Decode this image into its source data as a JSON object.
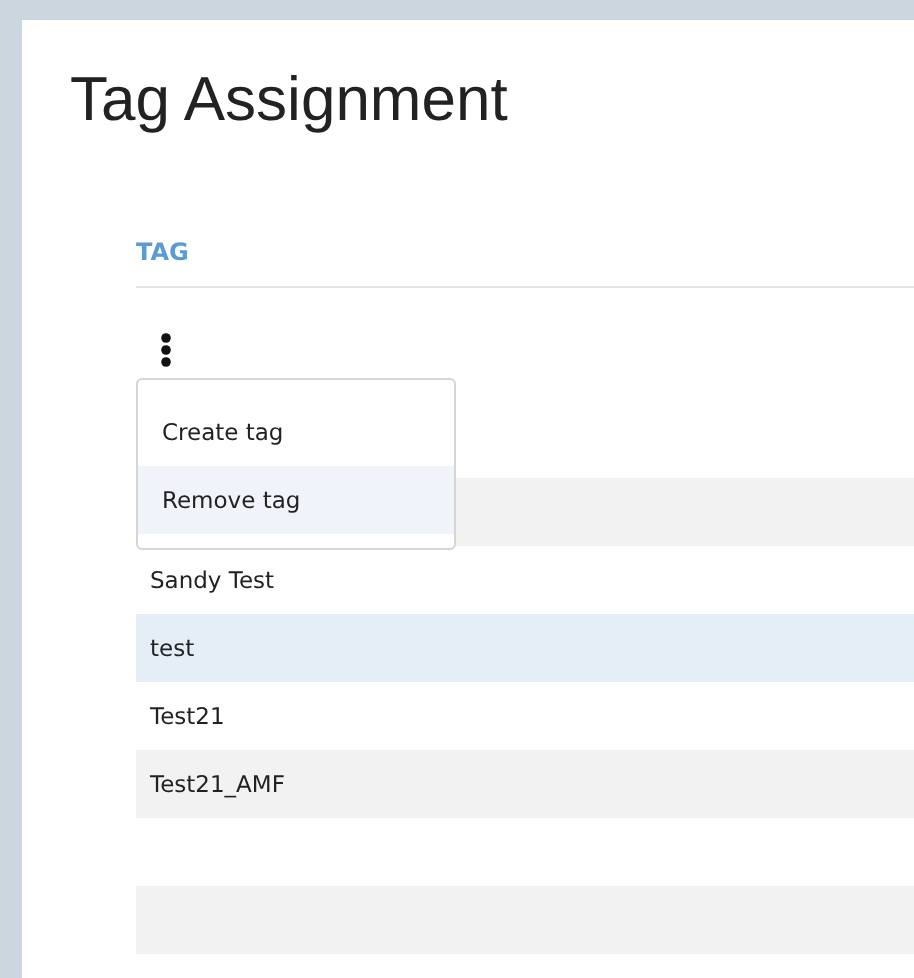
{
  "title": "Tag Assignment",
  "table": {
    "columns": [
      "TAG"
    ],
    "rows": [
      {
        "selected": false
      },
      {
        "selected": false
      },
      {
        "name": "Sandy Test",
        "selected": false
      },
      {
        "name": "test",
        "selected": true
      },
      {
        "name": "Test21",
        "selected": false
      },
      {
        "name": "Test21_AMF",
        "selected": false
      },
      {
        "selected": false
      },
      {
        "selected": false
      }
    ]
  },
  "menu": {
    "items": [
      {
        "label": "Create tag",
        "selected": false
      },
      {
        "label": "Remove tag",
        "selected": true
      }
    ]
  }
}
